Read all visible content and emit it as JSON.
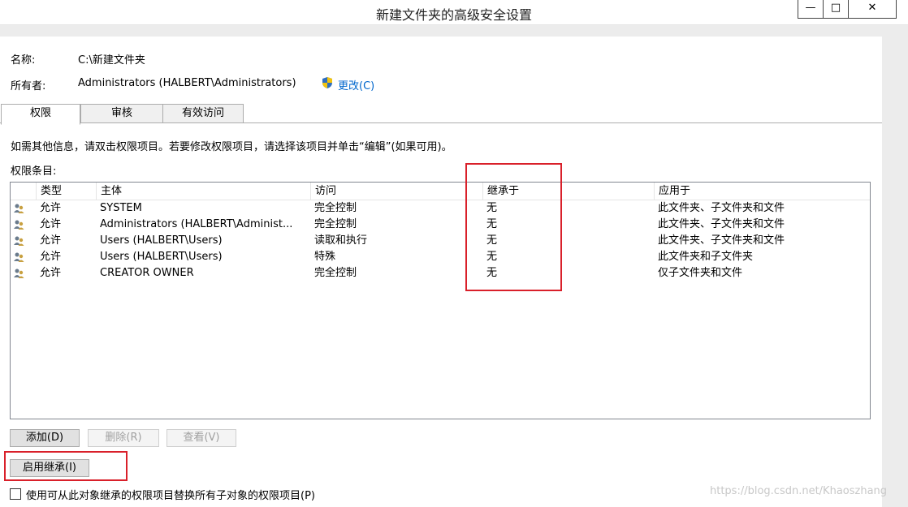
{
  "window": {
    "title": "新建文件夹的高级安全设置",
    "minimize": "—",
    "maximize": "□",
    "close": "✕"
  },
  "info": {
    "name_label": "名称:",
    "name_value": "C:\\新建文件夹",
    "owner_label": "所有者:",
    "owner_value": "Administrators (HALBERT\\Administrators)",
    "change_link": "更改(C)"
  },
  "tabs": [
    {
      "label": "权限"
    },
    {
      "label": "审核"
    },
    {
      "label": "有效访问"
    }
  ],
  "permissions": {
    "instructions": "如需其他信息，请双击权限项目。若要修改权限项目，请选择该项目并单击“编辑”(如果可用)。",
    "entries_label": "权限条目:",
    "columns": [
      "类型",
      "主体",
      "访问",
      "继承于",
      "应用于"
    ],
    "rows": [
      [
        "允许",
        "SYSTEM",
        "完全控制",
        "无",
        "此文件夹、子文件夹和文件"
      ],
      [
        "允许",
        "Administrators (HALBERT\\Administ...",
        "完全控制",
        "无",
        "此文件夹、子文件夹和文件"
      ],
      [
        "允许",
        "Users (HALBERT\\Users)",
        "读取和执行",
        "无",
        "此文件夹、子文件夹和文件"
      ],
      [
        "允许",
        "Users (HALBERT\\Users)",
        "特殊",
        "无",
        "此文件夹和子文件夹"
      ],
      [
        "允许",
        "CREATOR OWNER",
        "完全控制",
        "无",
        "仅子文件夹和文件"
      ]
    ],
    "buttons": {
      "add": "添加(D)",
      "remove": "删除(R)",
      "view": "查看(V)",
      "enable_inheritance": "启用继承(I)"
    },
    "replace_checkbox_label": "使用可从此对象继承的权限项目替换所有子对象的权限项目(P)"
  },
  "watermark": "https://blog.csdn.net/Khaoszhang",
  "colors": {
    "highlight_box": "#d9202a",
    "link": "#0066cc"
  }
}
